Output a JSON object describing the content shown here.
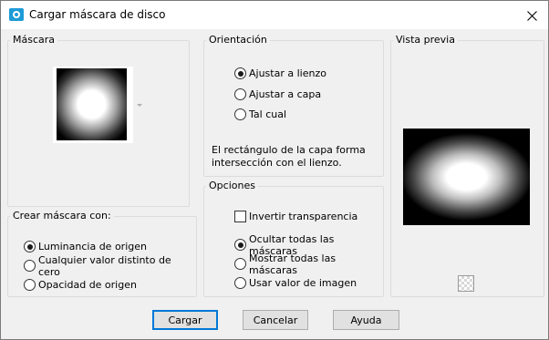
{
  "window": {
    "title": "Cargar máscara de disco"
  },
  "mask_group": {
    "legend": "Máscara"
  },
  "create_group": {
    "legend": "Crear máscara con:",
    "options": [
      "Luminancia de origen",
      "Cualquier valor distinto de cero",
      "Opacidad de origen"
    ],
    "selected": 0
  },
  "orientation_group": {
    "legend": "Orientación",
    "options": [
      "Ajustar a lienzo",
      "Ajustar a capa",
      "Tal cual"
    ],
    "selected": 0,
    "note": "El rectángulo de la capa forma intersección con el lienzo."
  },
  "options_group": {
    "legend": "Opciones",
    "invert_label": "Invertir transparencia",
    "invert_checked": false,
    "options": [
      "Ocultar todas las máscaras",
      "Mostrar todas las máscaras",
      "Usar valor de imagen"
    ],
    "selected": 0
  },
  "preview_group": {
    "legend": "Vista previa"
  },
  "buttons": {
    "load": "Cargar",
    "cancel": "Cancelar",
    "help": "Ayuda"
  },
  "colors": {
    "focus_border": "#0078d7",
    "icon_accent": "#1e9bd7"
  }
}
